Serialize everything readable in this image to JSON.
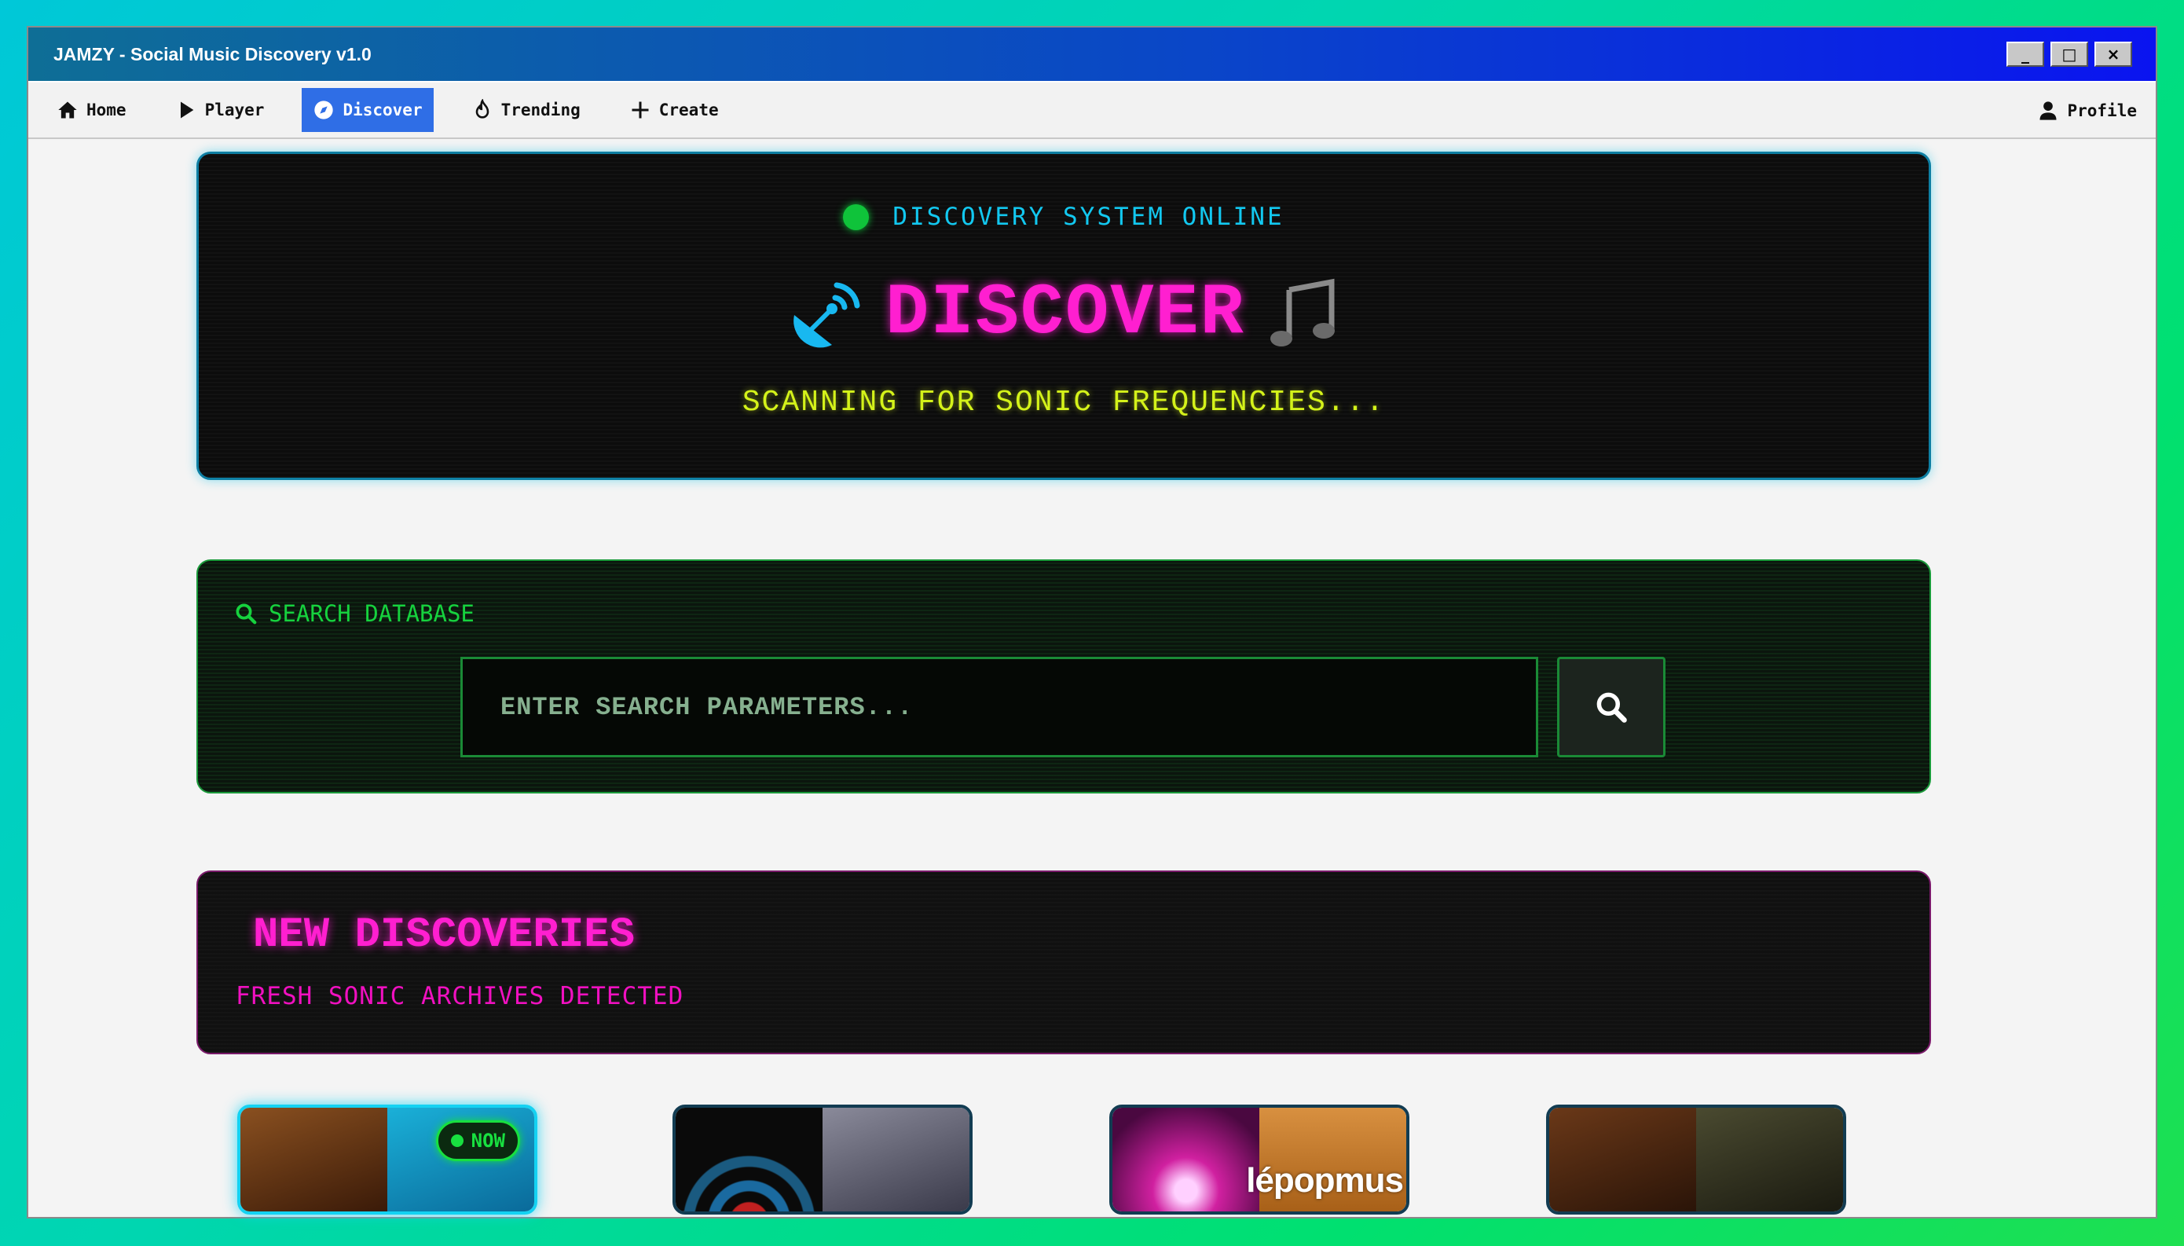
{
  "window": {
    "title": "JAMZY - Social Music Discovery v1.0",
    "controls": {
      "minimize": "_",
      "maximize": "□",
      "close": "×"
    }
  },
  "nav": {
    "items": [
      {
        "label": "Home",
        "icon": "home-icon"
      },
      {
        "label": "Player",
        "icon": "play-icon"
      },
      {
        "label": "Discover",
        "icon": "compass-icon",
        "active": true
      },
      {
        "label": "Trending",
        "icon": "fire-icon"
      },
      {
        "label": "Create",
        "icon": "plus-icon"
      }
    ],
    "profile": {
      "label": "Profile",
      "icon": "user-icon"
    },
    "active_color": "#2f6ee6"
  },
  "hero": {
    "status": "DISCOVERY SYSTEM ONLINE",
    "title": "DISCOVER",
    "subtitle": "SCANNING FOR SONIC FREQUENCIES...",
    "left_icon": "satellite-dish-icon",
    "right_icon": "music-notes-icon"
  },
  "search": {
    "label": "SEARCH DATABASE",
    "placeholder": "ENTER SEARCH PARAMETERS...",
    "value": ""
  },
  "discoveries": {
    "title": "NEW DISCOVERIES",
    "subtitle": "FRESH SONIC ARCHIVES DETECTED"
  },
  "cards": [
    {
      "badge": "NOW",
      "active": true,
      "colors": [
        "#6a3a14",
        "#1aa0c8"
      ]
    },
    {
      "active": false,
      "colors": [
        "#0e2a40",
        "#5a5a6a"
      ]
    },
    {
      "active": false,
      "colors": [
        "#b01890",
        "#d08a30"
      ],
      "overlay_text": "lépopmus"
    },
    {
      "active": false,
      "colors": [
        "#4a2410",
        "#2a2a1a"
      ]
    }
  ],
  "colors": {
    "neon_pink": "#ff1fd0",
    "neon_cyan": "#12c8f0",
    "neon_green": "#16d23e",
    "neon_yellow": "#d4f21a"
  }
}
